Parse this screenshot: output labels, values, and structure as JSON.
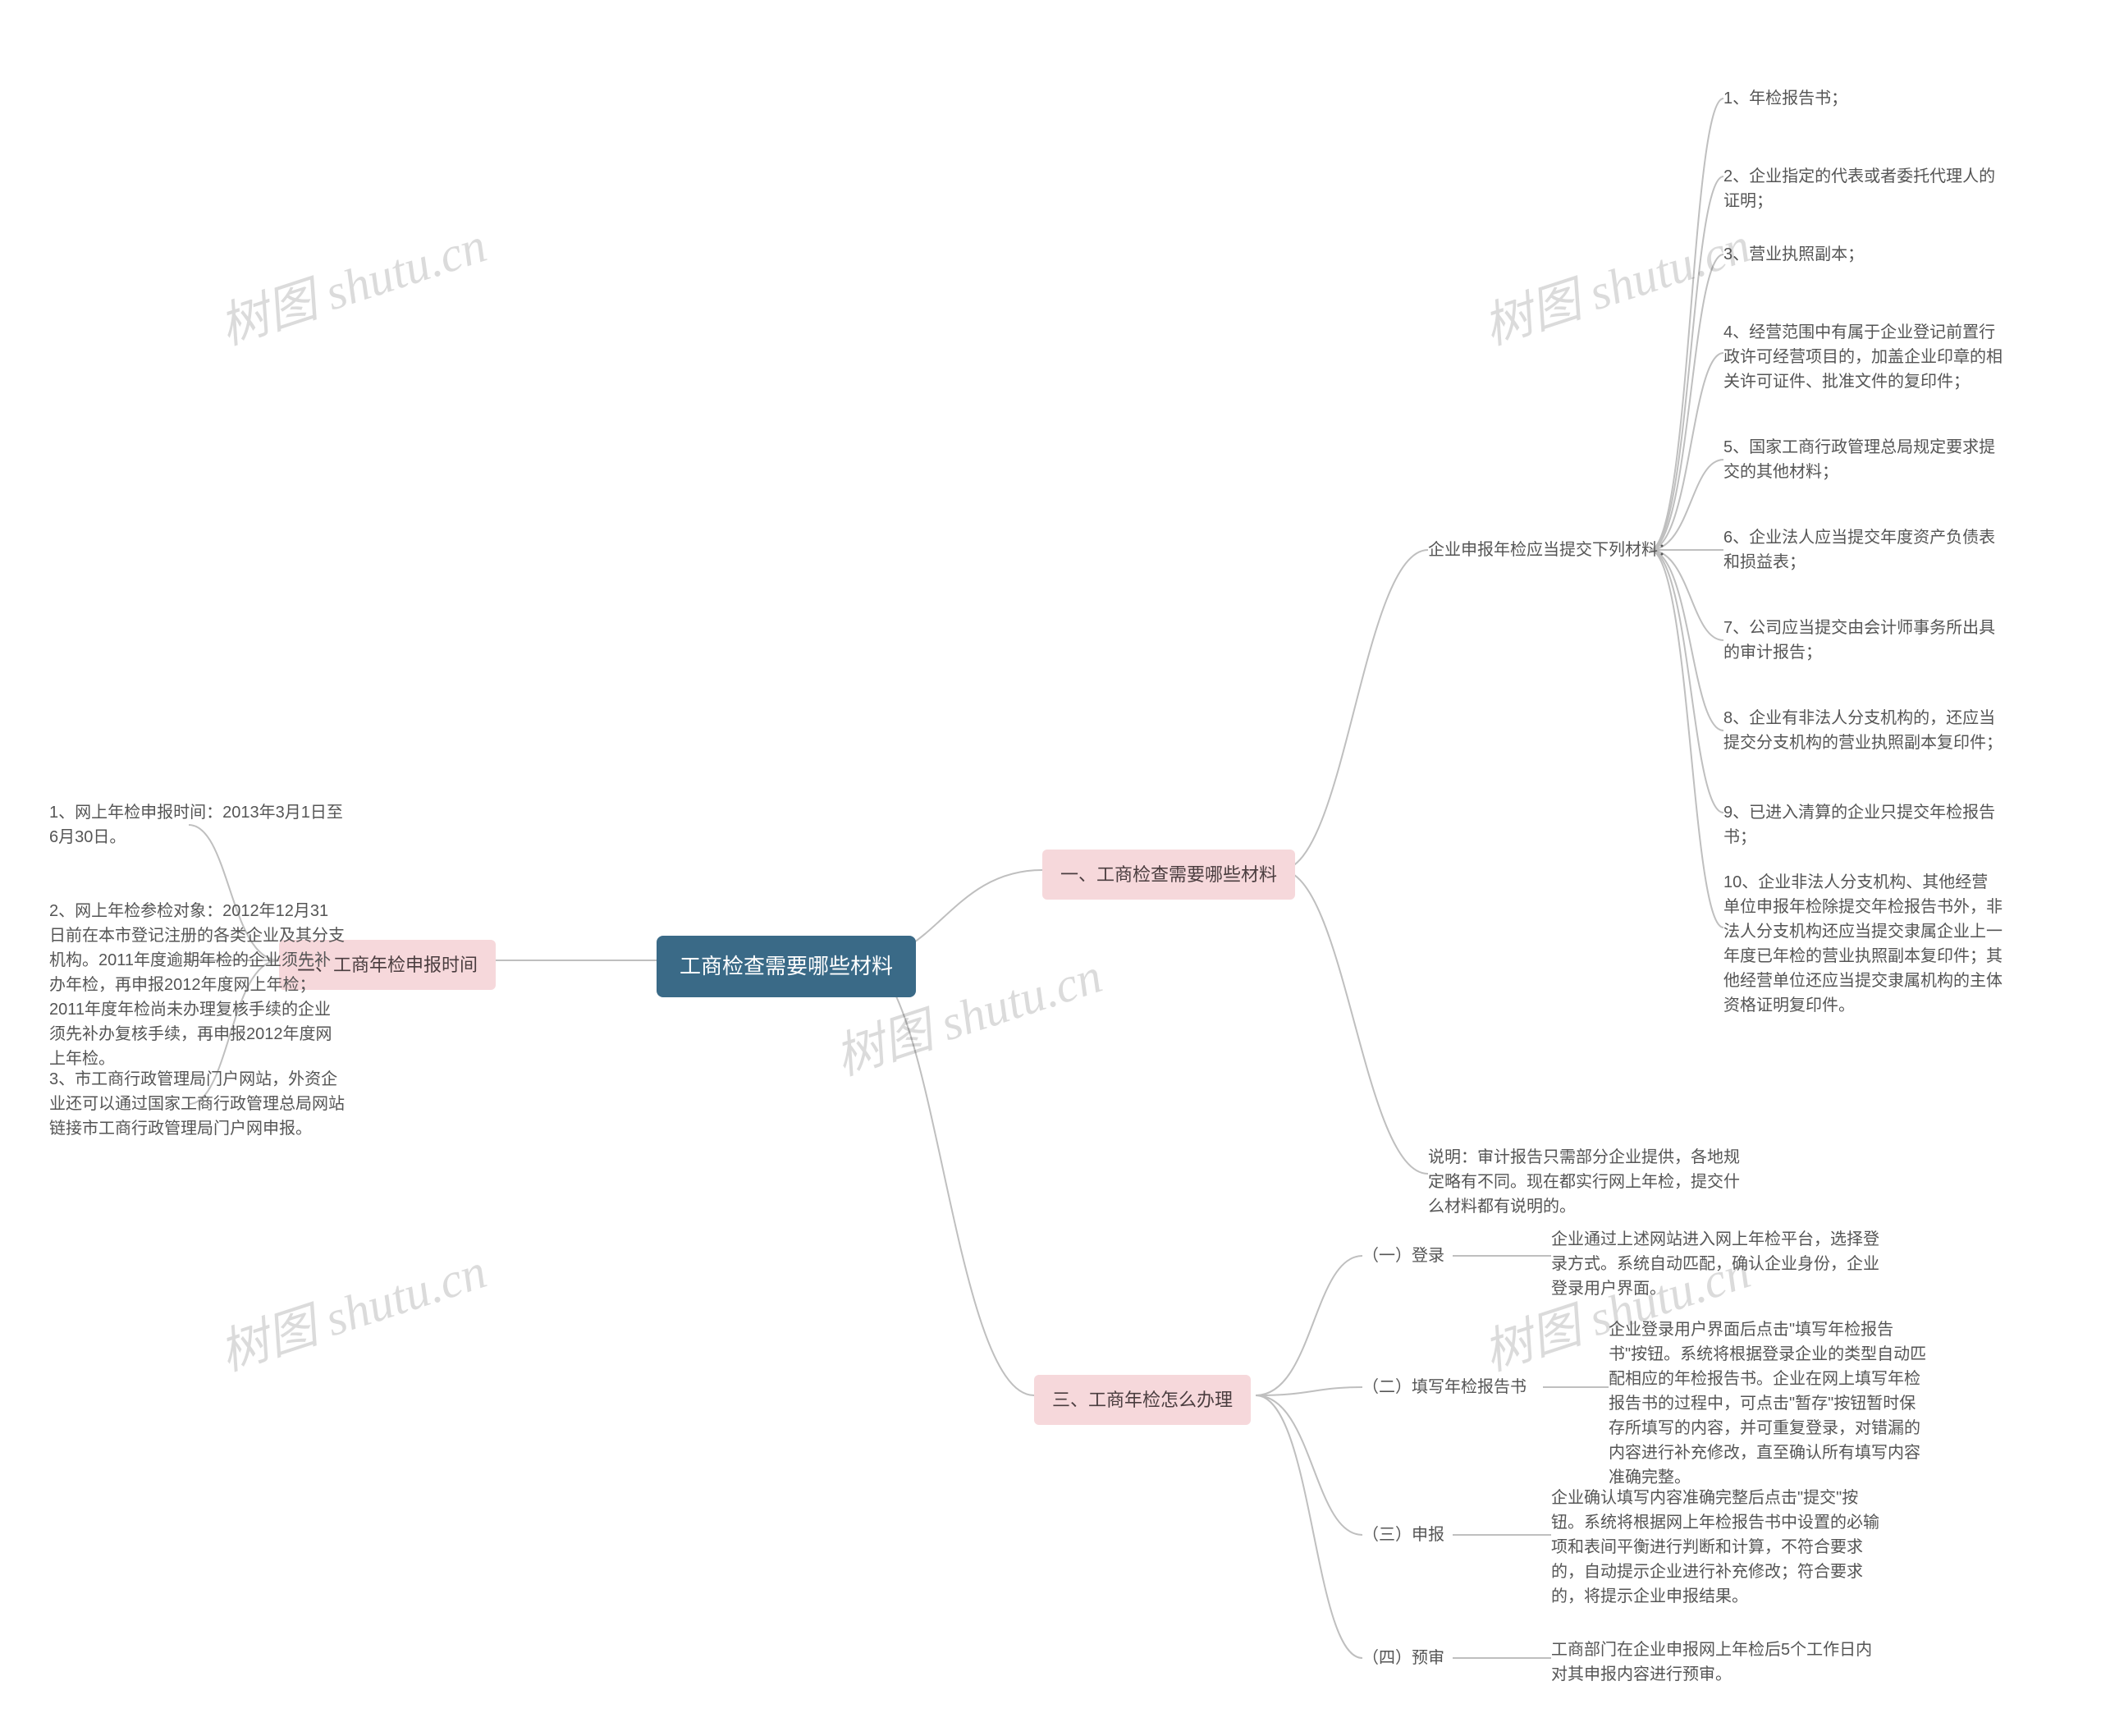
{
  "root": "工商检查需要哪些材料",
  "sections": {
    "one": {
      "title": "一、工商检查需要哪些材料",
      "materials_label": "企业申报年检应当提交下列材料：",
      "materials": [
        "1、年检报告书；",
        "2、企业指定的代表或者委托代理人的证明；",
        "3、营业执照副本；",
        "4、经营范围中有属于企业登记前置行政许可经营项目的，加盖企业印章的相关许可证件、批准文件的复印件；",
        "5、国家工商行政管理总局规定要求提交的其他材料；",
        "6、企业法人应当提交年度资产负债表和损益表；",
        "7、公司应当提交由会计师事务所出具的审计报告；",
        "8、企业有非法人分支机构的，还应当提交分支机构的营业执照副本复印件；",
        "9、已进入清算的企业只提交年检报告书；",
        "10、企业非法人分支机构、其他经营单位申报年检除提交年检报告书外，非法人分支机构还应当提交隶属企业上一年度已年检的营业执照副本复印件；其他经营单位还应当提交隶属机构的主体资格证明复印件。"
      ],
      "note": "说明：审计报告只需部分企业提供，各地规定略有不同。现在都实行网上年检，提交什么材料都有说明的。"
    },
    "two": {
      "title": "二、工商年检申报时间",
      "items": [
        "1、网上年检申报时间：2013年3月1日至6月30日。",
        "2、网上年检参检对象：2012年12月31日前在本市登记注册的各类企业及其分支机构。2011年度逾期年检的企业须先补办年检，再申报2012年度网上年检；2011年度年检尚未办理复核手续的企业须先补办复核手续，再申报2012年度网上年检。",
        "3、市工商行政管理局门户网站，外资企业还可以通过国家工商行政管理总局网站链接市工商行政管理局门户网申报。"
      ]
    },
    "three": {
      "title": "三、工商年检怎么办理",
      "steps": [
        {
          "label": "（一）登录",
          "desc": "企业通过上述网站进入网上年检平台，选择登录方式。系统自动匹配，确认企业身份，企业登录用户界面。"
        },
        {
          "label": "（二）填写年检报告书",
          "desc": "企业登录用户界面后点击\"填写年检报告书\"按钮。系统将根据登录企业的类型自动匹配相应的年检报告书。企业在网上填写年检报告书的过程中，可点击\"暂存\"按钮暂时保存所填写的内容，并可重复登录，对错漏的内容进行补充修改，直至确认所有填写内容准确完整。"
        },
        {
          "label": "（三）申报",
          "desc": "企业确认填写内容准确完整后点击\"提交\"按钮。系统将根据网上年检报告书中设置的必输项和表间平衡进行判断和计算，不符合要求的，自动提示企业进行补充修改；符合要求的，将提示企业申报结果。"
        },
        {
          "label": "（四）预审",
          "desc": "工商部门在企业申报网上年检后5个工作日内对其申报内容进行预审。"
        }
      ]
    }
  },
  "watermark": "树图 shutu.cn"
}
